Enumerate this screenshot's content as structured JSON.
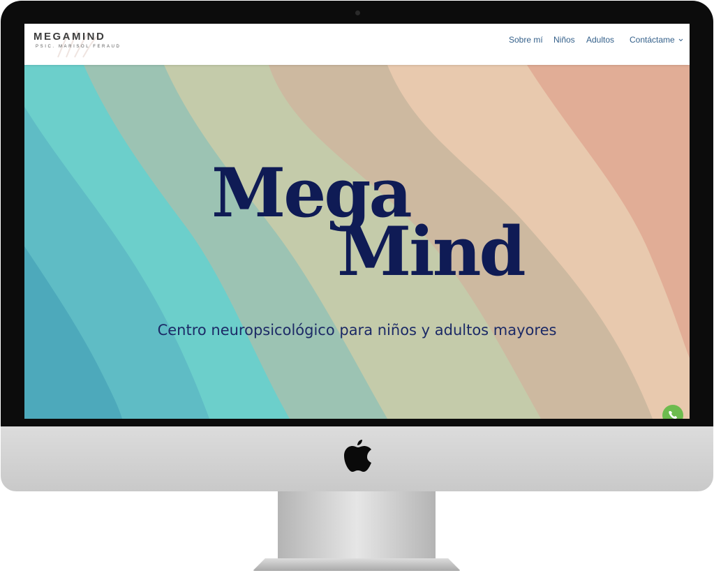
{
  "header": {
    "logo_title": "MEGAMIND",
    "logo_subtitle": "PSIC. MARISOL FERAUD",
    "nav": [
      {
        "label": "Sobre mí"
      },
      {
        "label": "Niños"
      },
      {
        "label": "Adultos"
      },
      {
        "label": "Contáctame",
        "has_dropdown": true
      }
    ]
  },
  "hero": {
    "title_line1": "Mega",
    "title_line2": "Mind",
    "tagline": "Centro neuropsicológico para niños y adultos mayores"
  },
  "icons": {
    "whatsapp": "whatsapp-icon",
    "dropdown": "chevron-down-icon",
    "apple": "apple-logo-icon"
  },
  "colors": {
    "nav_text": "#34608a",
    "title_navy": "#0f1b55",
    "wave_teal": "#6ccfcb",
    "wave_sage": "#9cc3b3",
    "wave_cream": "#c4cbaa",
    "wave_tan": "#cdb9a0",
    "wave_peach": "#e8c9ae",
    "wave_salmon": "#e1ad96"
  }
}
